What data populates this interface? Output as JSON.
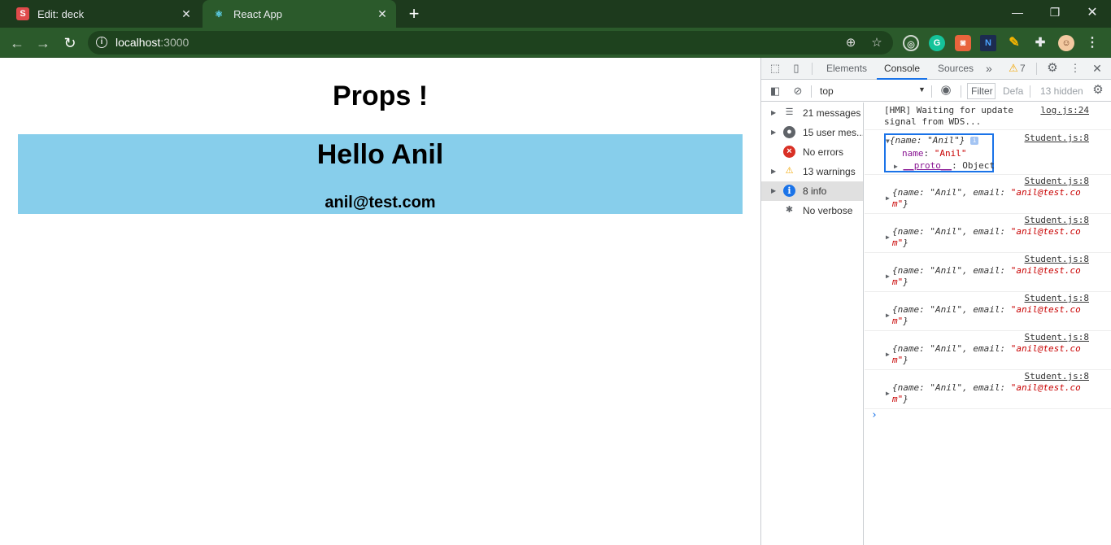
{
  "browser": {
    "tabs": [
      {
        "title": "Edit: deck",
        "favicon": "S",
        "active": false
      },
      {
        "title": "React App",
        "favicon": "react-icon",
        "active": true
      }
    ],
    "new_tab_label": "+",
    "url_host": "localhost",
    "url_port": ":3000"
  },
  "page": {
    "heading": "Props !",
    "student": {
      "greeting": "Hello Anil",
      "email": "anil@test.com",
      "background_color": "#87ceeb"
    }
  },
  "devtools": {
    "tabs": [
      "Elements",
      "Console",
      "Sources"
    ],
    "active_tab": "Console",
    "more_tabs": "»",
    "warning_count": "7",
    "context": "top",
    "filter_placeholder": "Filter",
    "levels_label": "Defa",
    "hidden_label": "13 hidden",
    "sidebar": [
      {
        "label": "21 messages",
        "icon": "list-icon"
      },
      {
        "label": "15 user mes...",
        "icon": "user-icon"
      },
      {
        "label": "No errors",
        "icon": "error-icon"
      },
      {
        "label": "13 warnings",
        "icon": "warning-icon"
      },
      {
        "label": "8 info",
        "icon": "info-icon"
      },
      {
        "label": "No verbose",
        "icon": "bug-icon"
      }
    ],
    "console": {
      "hmr_line1": "[HMR] Waiting for update",
      "hmr_line2": "signal from WDS...",
      "hmr_source": "log.js:24",
      "expanded_source": "Student.js:8",
      "expanded_summary": "{name: \"Anil\"}",
      "expanded_key": "name",
      "expanded_value": "\"Anil\"",
      "proto_key": "__proto__",
      "proto_value": ": Object",
      "log_source": "Student.js:8",
      "log_line1_prefix": "{name: \"Anil\", email: ",
      "log_line1_str": "\"anil@test.co",
      "log_line2_str": "m\"",
      "log_line2_suffix": "}",
      "log_count": 6,
      "prompt": "›"
    }
  }
}
